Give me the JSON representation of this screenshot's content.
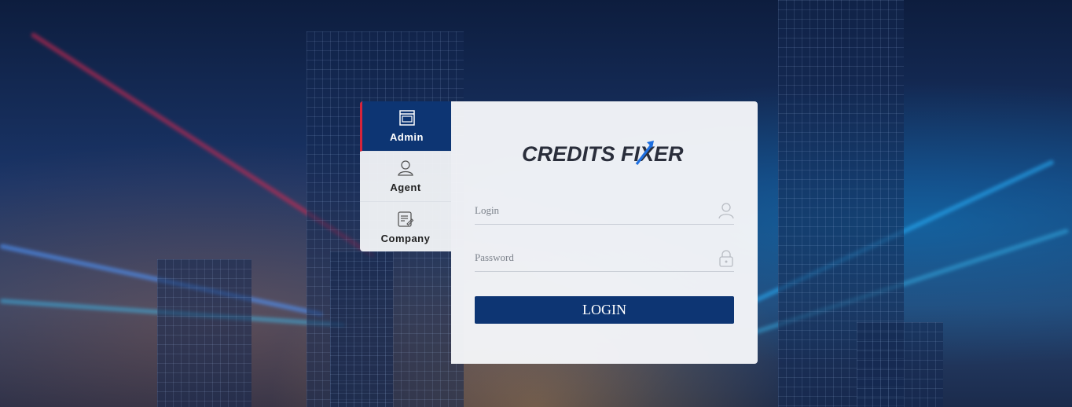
{
  "tabs": [
    {
      "label": "Admin",
      "icon": "admin-window-icon",
      "active": true
    },
    {
      "label": "Agent",
      "icon": "user-icon",
      "active": false
    },
    {
      "label": "Company",
      "icon": "document-icon",
      "active": false
    }
  ],
  "brand": {
    "name": "CREDITS FIXER"
  },
  "form": {
    "login_placeholder": "Login",
    "password_placeholder": "Password",
    "submit_label": "LOGIN"
  },
  "colors": {
    "primary": "#0d3573",
    "accent": "#d6243a",
    "logo_arrow": "#1e6fe0"
  }
}
